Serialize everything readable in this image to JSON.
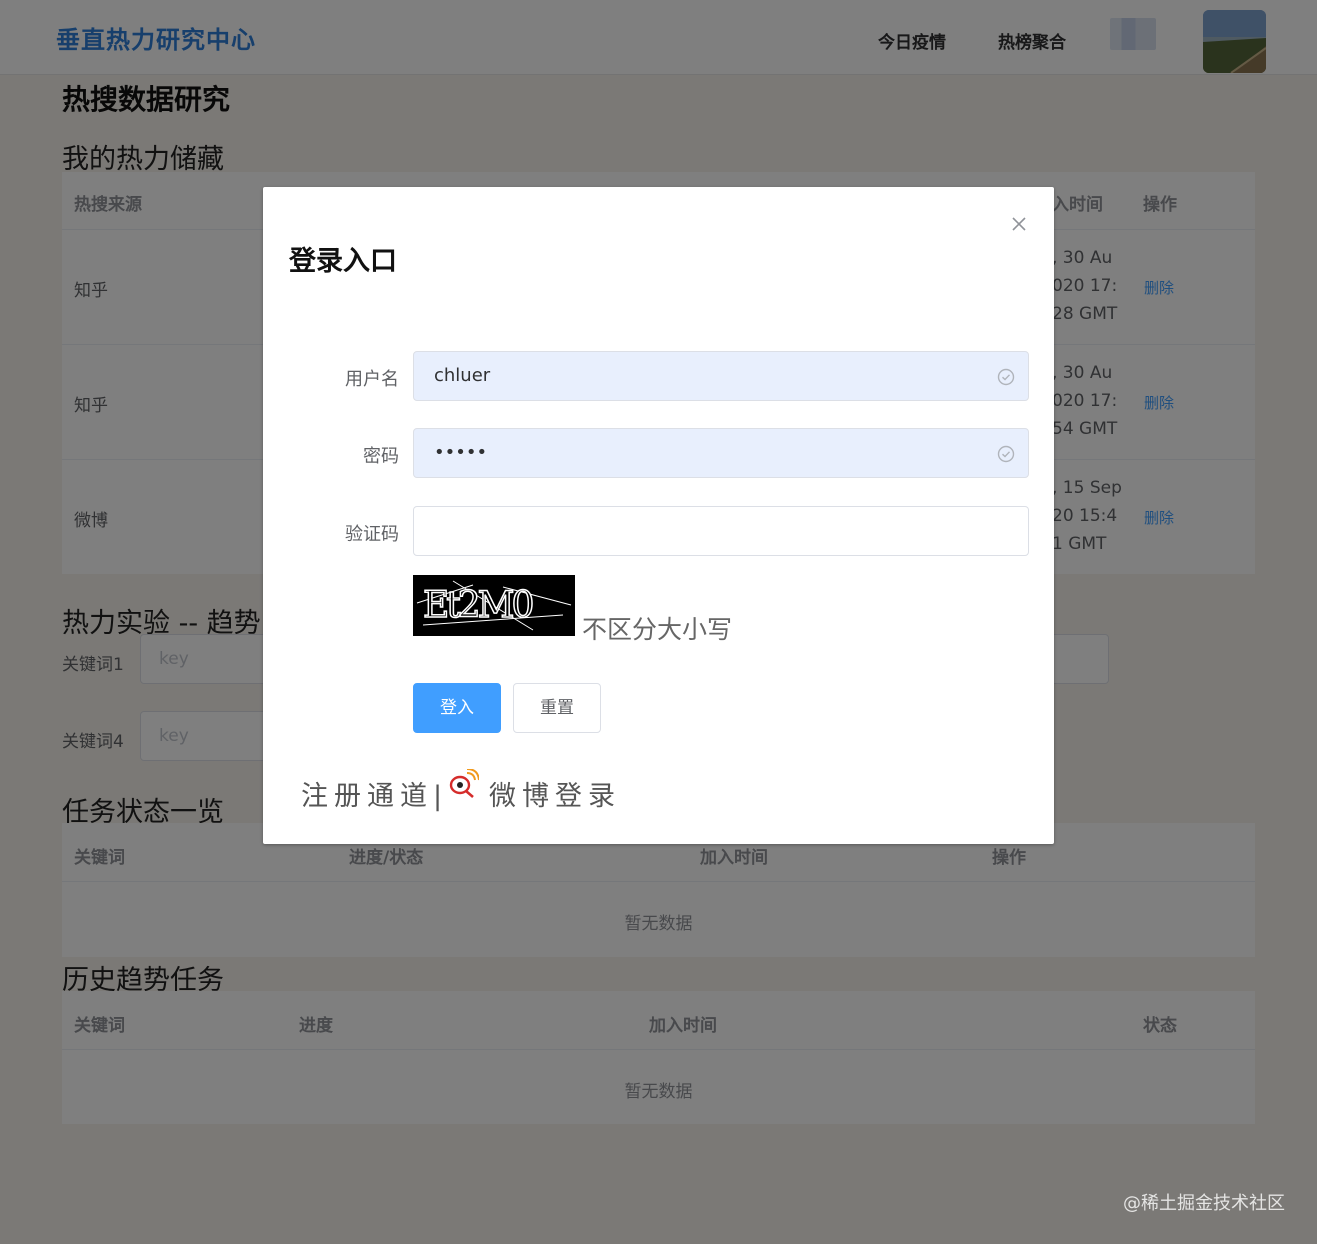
{
  "header": {
    "brand": "垂直热力研究中心",
    "nav": [
      "今日疫情",
      "热榜聚合"
    ]
  },
  "page": {
    "title": "热搜数据研究",
    "favorites": {
      "heading": "我的热力储藏",
      "columns": [
        "热搜来源",
        "入时间",
        "操作"
      ],
      "rows": [
        {
          "source": "知乎",
          "time_lines": [
            ", 30 Au",
            "020 17:",
            "28 GMT"
          ],
          "action": "删除"
        },
        {
          "source": "知乎",
          "time_lines": [
            ", 30 Au",
            "020 17:",
            "54 GMT"
          ],
          "action": "删除"
        },
        {
          "source": "微博",
          "time_lines": [
            ", 15 Sep",
            "20 15:4",
            "1 GMT"
          ],
          "action": "删除"
        }
      ]
    },
    "experiment": {
      "heading": "热力实验 -- 趋势",
      "fields": [
        {
          "label": "关键词1",
          "placeholder": "key"
        },
        {
          "label": "关键词4",
          "placeholder": "key"
        }
      ]
    },
    "tasks": {
      "heading": "任务状态一览",
      "columns": [
        "关键词",
        "进度/状态",
        "加入时间",
        "操作"
      ],
      "empty": "暂无数据"
    },
    "history": {
      "heading": "历史趋势任务",
      "columns": [
        "关键词",
        "进度",
        "加入时间",
        "状态"
      ],
      "empty": "暂无数据"
    }
  },
  "modal": {
    "title": "登录入口",
    "username_label": "用户名",
    "username_value": "chluer",
    "password_label": "密码",
    "password_value": "•••••",
    "captcha_label": "验证码",
    "captcha_value": "",
    "captcha_image_text": "Et2M0",
    "captcha_hint": "不区分大小写",
    "login_button": "登入",
    "reset_button": "重置",
    "register_link": "注册通道|",
    "weibo_login": "微博登录"
  },
  "watermark": "@稀土掘金技术社区",
  "colors": {
    "brand": "#2f7ed8",
    "primary": "#409eff",
    "autofill": "#e8effd"
  },
  "icons": [
    "close-icon",
    "check-circle-icon",
    "weibo-icon"
  ]
}
